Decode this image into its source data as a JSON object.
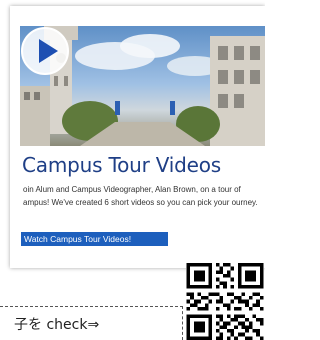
{
  "card": {
    "title": "Campus Tour Videos",
    "description": "oin Alum and Campus Videographer, Alan Brown, on a tour of ampus! We've created 6 short videos so you can pick your ourney.",
    "button_label": "Watch Campus Tour Videos!",
    "thumbnail": {
      "icon": "play-icon"
    }
  },
  "callout": {
    "text": "子を check⇒"
  },
  "qr": {
    "icon": "qr-code-icon"
  },
  "colors": {
    "title": "#1f3f86",
    "button": "#1d5fbd",
    "play_button": "#1d4fb2"
  }
}
